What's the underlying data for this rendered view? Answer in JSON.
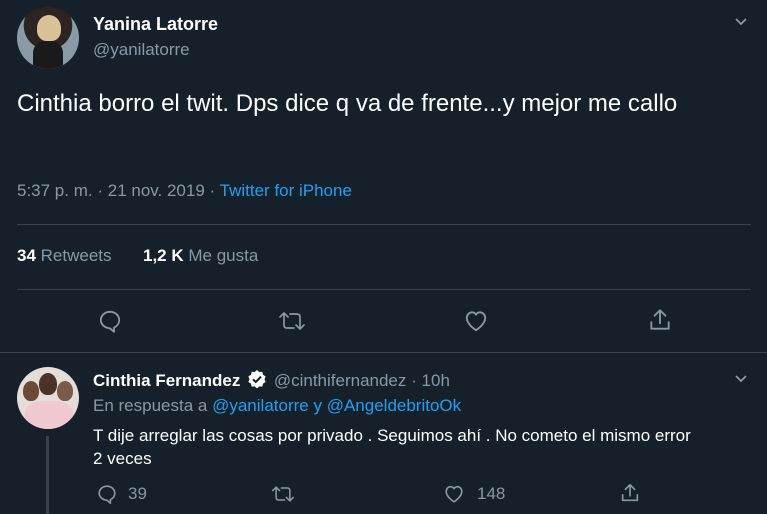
{
  "tweet": {
    "author_name": "Yanina Latorre",
    "author_handle": "@yanilatorre",
    "text": "Cinthia borro el twit. Dps dice q va de frente...y mejor me callo",
    "time": "5:37 p. m.",
    "sep": "·",
    "date": "21 nov. 2019",
    "source": "Twitter for iPhone",
    "retweets_count": "34",
    "retweets_label": "Retweets",
    "likes_count": "1,2 K",
    "likes_label": "Me gusta"
  },
  "reply": {
    "author_name": "Cinthia Fernandez",
    "author_handle": "@cinthifernandez",
    "sep": "·",
    "age": "10h",
    "replying_prefix": "En respuesta a",
    "mention1": "@yanilatorre",
    "conj": "y",
    "mention2": "@AngeldebritoOk",
    "text": "T dije arreglar las cosas por privado . Seguimos ahí . No cometo el mismo error 2 veces",
    "reply_count": "39",
    "like_count": "148"
  },
  "colors": {
    "background": "#15202b",
    "accent": "#1da1f2",
    "muted": "#8899a6",
    "divider": "#38444d"
  },
  "icons": [
    "chevron-down-icon",
    "reply-icon",
    "retweet-icon",
    "heart-icon",
    "share-icon",
    "verified-badge-icon"
  ]
}
